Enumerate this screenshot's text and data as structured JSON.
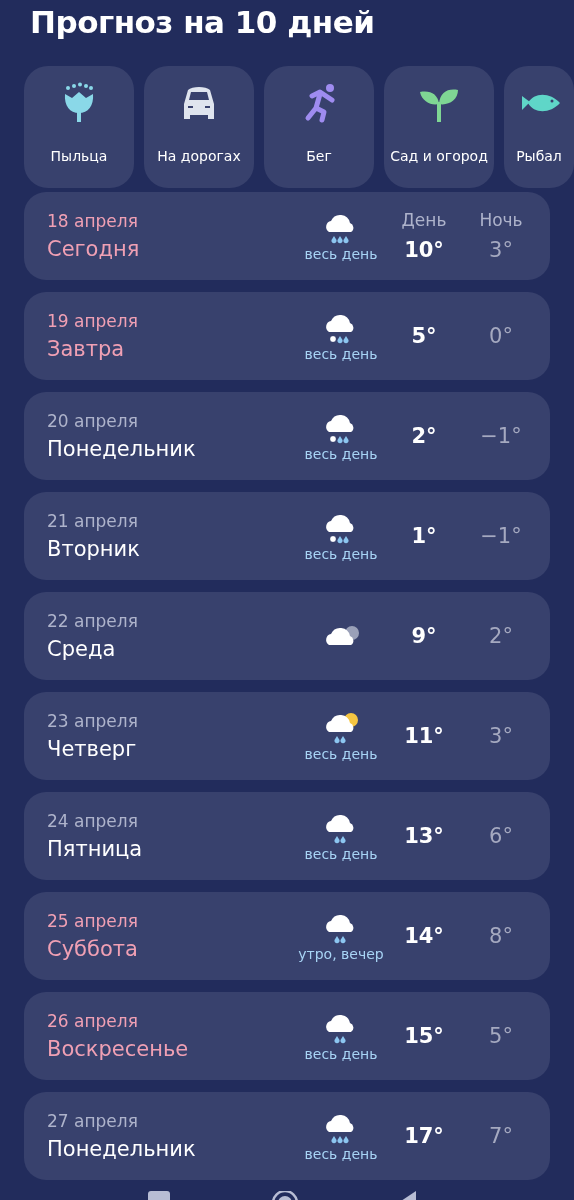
{
  "title": "Прогноз на 10 дней",
  "activities": [
    {
      "kind": "pollen",
      "label": "Пыльца"
    },
    {
      "kind": "roads",
      "label": "На дорогах"
    },
    {
      "kind": "running",
      "label": "Бег"
    },
    {
      "kind": "garden",
      "label": "Сад и огород"
    },
    {
      "kind": "fishing",
      "label": "Рыбал"
    }
  ],
  "column_headers": {
    "day": "День",
    "night": "Ночь"
  },
  "days": [
    {
      "date": "18 апреля",
      "weekday": "Сегодня",
      "highlighted": true,
      "kind": "rain",
      "precipitation": "весь день",
      "day_temp": "10°",
      "night_temp": "3°"
    },
    {
      "date": "19 апреля",
      "weekday": "Завтра",
      "highlighted": true,
      "kind": "sleet",
      "precipitation": "весь день",
      "day_temp": "5°",
      "night_temp": "0°"
    },
    {
      "date": "20 апреля",
      "weekday": "Понедельник",
      "highlighted": false,
      "kind": "sleet",
      "precipitation": "весь день",
      "day_temp": "2°",
      "night_temp": "−1°"
    },
    {
      "date": "21 апреля",
      "weekday": "Вторник",
      "highlighted": false,
      "kind": "sleet",
      "precipitation": "весь день",
      "day_temp": "1°",
      "night_temp": "−1°"
    },
    {
      "date": "22 апреля",
      "weekday": "Среда",
      "highlighted": false,
      "kind": "cloudy",
      "day_temp": "9°",
      "night_temp": "2°"
    },
    {
      "date": "23 апреля",
      "weekday": "Четверг",
      "highlighted": false,
      "kind": "sun_rain",
      "precipitation": "весь день",
      "day_temp": "11°",
      "night_temp": "3°"
    },
    {
      "date": "24 апреля",
      "weekday": "Пятница",
      "highlighted": false,
      "kind": "light_rain",
      "precipitation": "весь день",
      "day_temp": "13°",
      "night_temp": "6°"
    },
    {
      "date": "25 апреля",
      "weekday": "Суббота",
      "highlighted": true,
      "kind": "light_rain",
      "precipitation": "утро, вечер",
      "day_temp": "14°",
      "night_temp": "8°"
    },
    {
      "date": "26 апреля",
      "weekday": "Воскресенье",
      "highlighted": true,
      "kind": "light_rain",
      "precipitation": "весь день",
      "day_temp": "15°",
      "night_temp": "5°"
    },
    {
      "date": "27 апреля",
      "weekday": "Понедельник",
      "highlighted": false,
      "kind": "rain",
      "precipitation": "весь день",
      "day_temp": "17°",
      "night_temp": "7°"
    }
  ]
}
